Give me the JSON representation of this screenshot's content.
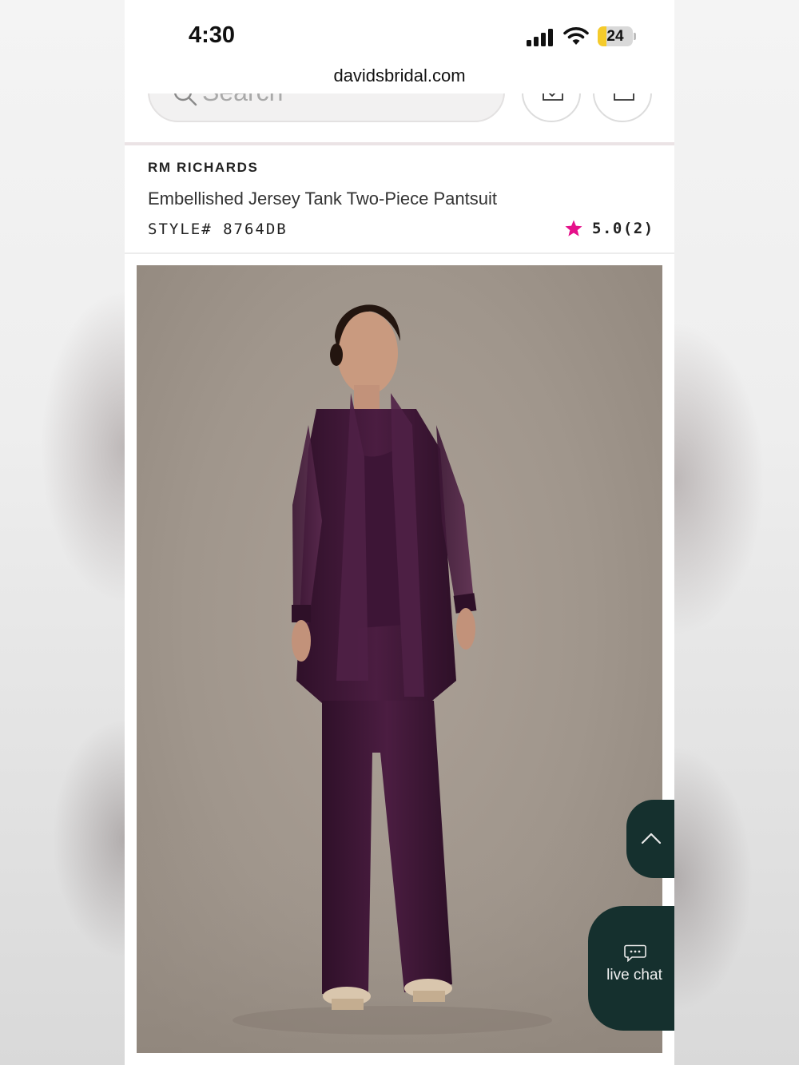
{
  "status_bar": {
    "time": "4:30",
    "battery_level": "24",
    "battery_fraction": 0.24
  },
  "browser": {
    "url": "davidsbridal.com"
  },
  "header": {
    "search_placeholder": "Search"
  },
  "product": {
    "brand": "RM RICHARDS",
    "name": "Embellished Jersey Tank Two-Piece Pantsuit",
    "style_number": "STYLE# 8764DB",
    "rating_text": "5.0(2)",
    "rating_star_color": "#e5108a"
  },
  "floating": {
    "live_chat_label": "live chat"
  },
  "colors": {
    "accent_dark_teal": "#15302e",
    "outfit_plum": "#4a1d3f",
    "backdrop_taupe": "#a49a90"
  }
}
